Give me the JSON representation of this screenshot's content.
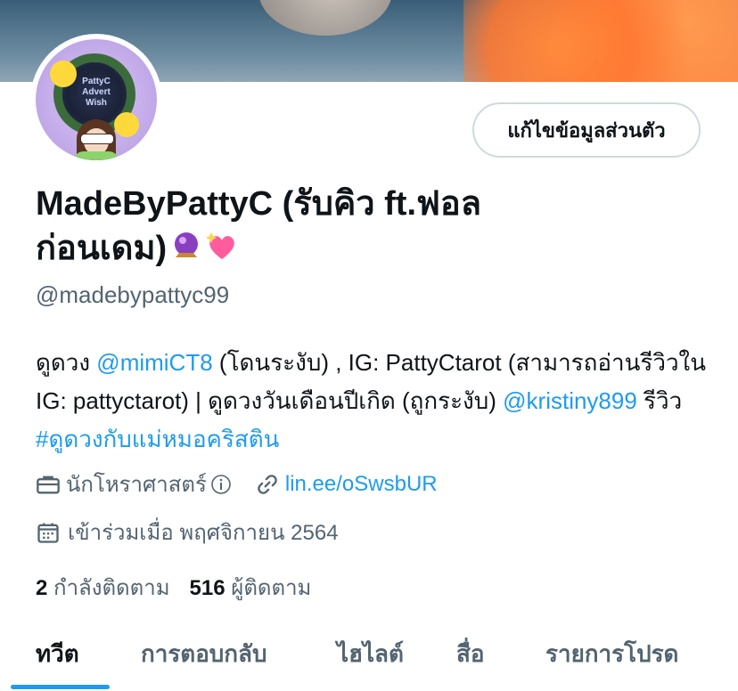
{
  "profile": {
    "edit_button": "แก้ไขข้อมูลส่วนตัว",
    "name_line1": "MadeByPattyC (รับคิว ft.ฟอล",
    "name_line2": "ก่อนเดม)",
    "name_emojis": [
      "crystal-ball-emoji",
      "sparkling-heart-emoji"
    ],
    "handle": "@madebypattyc99",
    "avatar_text": "PattyC Advert Wish"
  },
  "bio": {
    "p1": "ดูดวง ",
    "mention1": "@mimiCT8",
    "p2": " (โดนระงับ) , IG: PattyCtarot (สามารถอ่านรีวิวใน IG: pattyctarot) | ดูดวงวันเดือนปีเกิด (ถูกระงับ) ",
    "mention2": "@kristiny899",
    "p3": " รีวิว ",
    "hashtag": "#ดูดวงกับแม่หมอคริสติน"
  },
  "meta": {
    "category": "นักโหราศาสตร์",
    "link": "lin.ee/oSwsbUR",
    "joined": "เข้าร่วมเมื่อ พฤศจิกายน 2564"
  },
  "stats": {
    "following_count": "2",
    "following_label": "กำลังติดตาม",
    "followers_count": "516",
    "followers_label": "ผู้ติดตาม"
  },
  "tabs": [
    "ทวีต",
    "การตอบกลับ",
    "ไฮไลต์",
    "สื่อ",
    "รายการโปรด"
  ],
  "colors": {
    "accent": "#1d9bf0",
    "secondary_text": "#536471",
    "primary_text": "#0f1419"
  }
}
